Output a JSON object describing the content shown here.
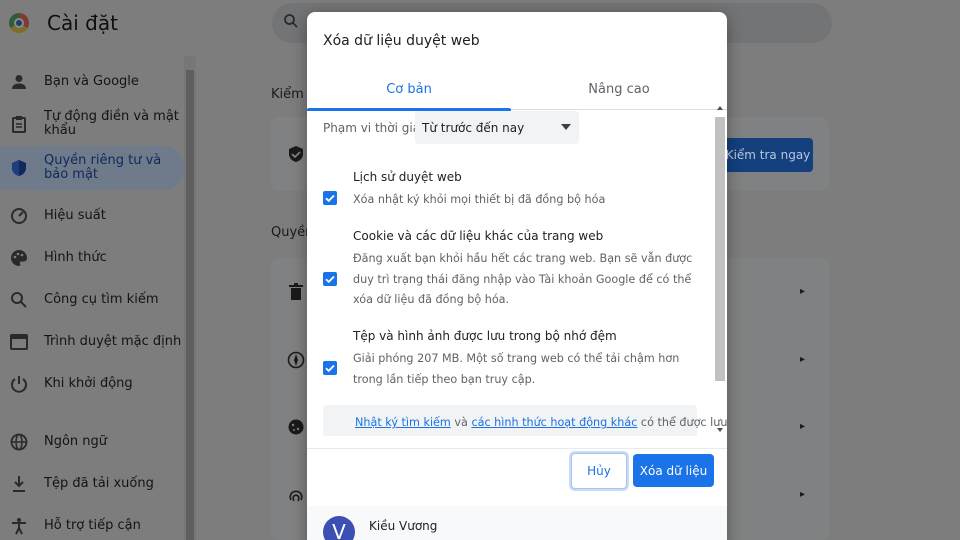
{
  "app": {
    "title": "Cài đặt"
  },
  "sidebar": {
    "items": [
      {
        "label": "Bạn và Google",
        "icon": "person-icon"
      },
      {
        "label": "Tự động điền và mật khẩu",
        "icon": "clipboard-icon"
      },
      {
        "label": "Quyền riêng tư và bảo mật",
        "icon": "shield-icon",
        "active": true
      },
      {
        "label": "Hiệu suất",
        "icon": "speedometer-icon"
      },
      {
        "label": "Hình thức",
        "icon": "palette-icon"
      },
      {
        "label": "Công cụ tìm kiếm",
        "icon": "search-icon"
      },
      {
        "label": "Trình duyệt mặc định",
        "icon": "browser-icon"
      },
      {
        "label": "Khi khởi động",
        "icon": "power-icon"
      },
      {
        "label": "Ngôn ngữ",
        "icon": "globe-icon"
      },
      {
        "label": "Tệp đã tải xuống",
        "icon": "download-icon"
      },
      {
        "label": "Hỗ trợ tiếp cận",
        "icon": "accessibility-icon"
      }
    ]
  },
  "background": {
    "safety_heading": "Kiểm t",
    "privacy_heading": "Quyền",
    "check_now_button": "Kiểm tra ngay"
  },
  "dialog": {
    "title": "Xóa dữ liệu duyệt web",
    "tabs": [
      {
        "label": "Cơ bản",
        "active": true
      },
      {
        "label": "Nâng cao",
        "active": false
      }
    ],
    "time_range": {
      "label": "Phạm vi thời gian",
      "value": "Từ trước đến nay"
    },
    "options": [
      {
        "title": "Lịch sử duyệt web",
        "description": "Xóa nhật ký khỏi mọi thiết bị đã đồng bộ hóa",
        "checked": true
      },
      {
        "title": "Cookie và các dữ liệu khác của trang web",
        "description": "Đăng xuất bạn khỏi hầu hết các trang web. Bạn sẽ vẫn được duy trì trạng thái đăng nhập vào Tài khoản Google để có thể xóa dữ liệu đã đồng bộ hóa.",
        "checked": true
      },
      {
        "title": "Tệp và hình ảnh được lưu trong bộ nhớ đệm",
        "description": "Giải phóng 207 MB. Một số trang web có thể tải chậm hơn trong lần tiếp theo bạn truy cập.",
        "checked": true
      }
    ],
    "info": {
      "link1": "Nhật ký tìm kiếm",
      "connector": " và ",
      "link2": "các hình thức hoạt động khác",
      "tail": " có thể được lưu vào"
    },
    "cancel_button": "Hủy",
    "clear_button": "Xóa dữ liệu",
    "account": {
      "initial": "V",
      "name": "Kiều Vương"
    }
  },
  "colors": {
    "accent": "#1a73e8",
    "scrim": "#7d7d7e"
  }
}
